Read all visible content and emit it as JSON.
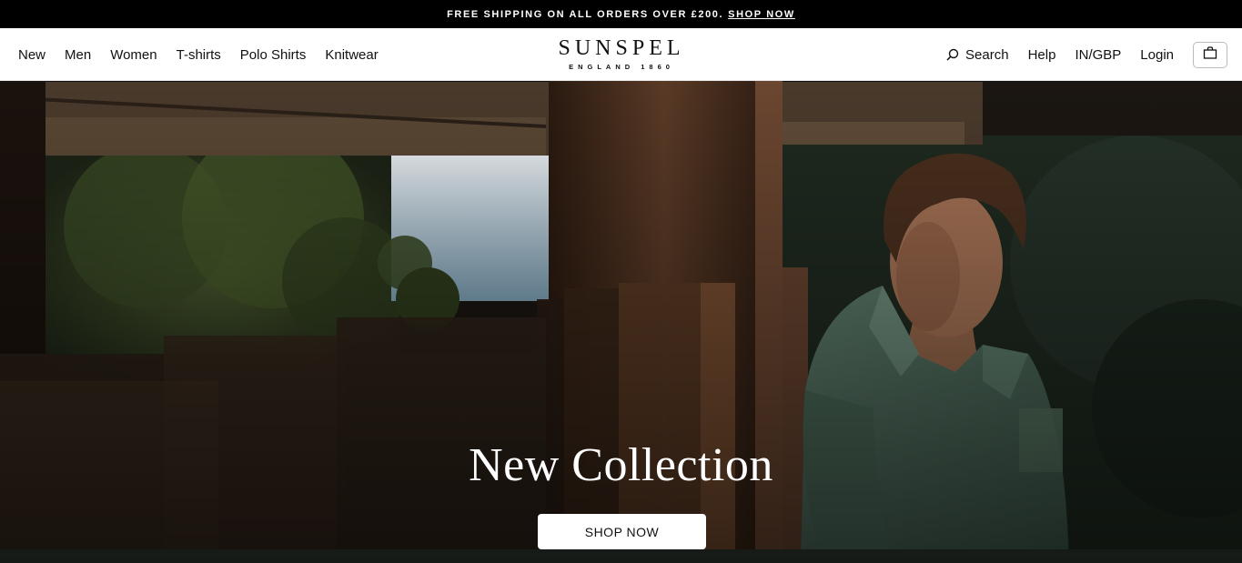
{
  "promo": {
    "text": "FREE SHIPPING ON ALL ORDERS OVER £200.",
    "link": "SHOP NOW"
  },
  "header": {
    "nav": [
      "New",
      "Men",
      "Women",
      "T-shirts",
      "Polo Shirts",
      "Knitwear"
    ],
    "logo": {
      "brand": "SUNSPEL",
      "tagline": "ENGLAND 1860"
    },
    "right": {
      "search": "Search",
      "help": "Help",
      "region": "IN/GBP",
      "login": "Login"
    },
    "icons": {
      "search": "search-icon",
      "bag": "shopping-bag-icon"
    }
  },
  "hero": {
    "title": "New Collection",
    "cta": "SHOP NOW"
  }
}
